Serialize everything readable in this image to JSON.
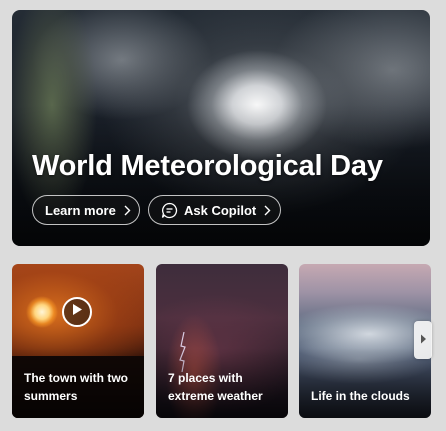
{
  "hero": {
    "title": "World Meteorological Day",
    "learn_more_label": "Learn more",
    "ask_copilot_label": "Ask Copilot",
    "icons": [
      "chevron-right-icon",
      "copilot-chat-icon"
    ]
  },
  "cards": [
    {
      "title": "The town with two summers",
      "icon": "play-icon"
    },
    {
      "title": "7 places with extreme weather"
    },
    {
      "title": "Life in the clouds"
    }
  ],
  "carousel": {
    "next_icon": "chevron-right-icon"
  },
  "colors": {
    "background": "#dcdcdc",
    "text": "#ffffff"
  }
}
